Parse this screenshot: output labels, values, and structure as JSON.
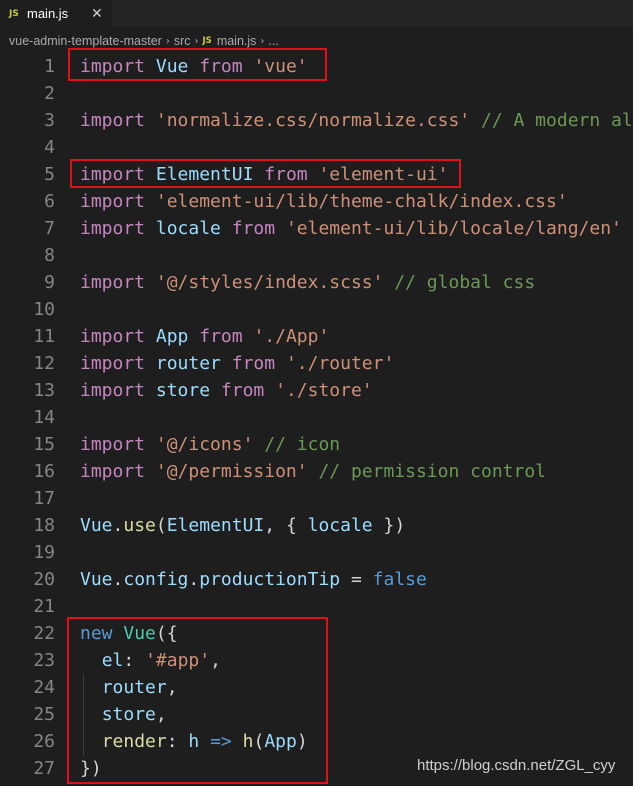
{
  "tab": {
    "icon": "JS",
    "filename": "main.js",
    "close_glyph": "✕"
  },
  "breadcrumb": {
    "folder": "vue-admin-template-master",
    "subfolder": "src",
    "file_icon": "JS",
    "file": "main.js",
    "symbol": "..."
  },
  "code_lines": [
    {
      "num": "1",
      "tokens": [
        [
          "kw",
          "import"
        ],
        [
          "pun",
          " "
        ],
        [
          "id",
          "Vue"
        ],
        [
          "pun",
          " "
        ],
        [
          "kw",
          "from"
        ],
        [
          "pun",
          " "
        ],
        [
          "str",
          "'vue'"
        ]
      ]
    },
    {
      "num": "2",
      "tokens": []
    },
    {
      "num": "3",
      "tokens": [
        [
          "kw",
          "import"
        ],
        [
          "pun",
          " "
        ],
        [
          "str",
          "'normalize.css/normalize.css'"
        ],
        [
          "pun",
          " "
        ],
        [
          "cmt",
          "// A modern al"
        ]
      ]
    },
    {
      "num": "4",
      "tokens": []
    },
    {
      "num": "5",
      "tokens": [
        [
          "kw",
          "import"
        ],
        [
          "pun",
          " "
        ],
        [
          "id",
          "ElementUI"
        ],
        [
          "pun",
          " "
        ],
        [
          "kw",
          "from"
        ],
        [
          "pun",
          " "
        ],
        [
          "str",
          "'element-ui'"
        ]
      ]
    },
    {
      "num": "6",
      "tokens": [
        [
          "kw",
          "import"
        ],
        [
          "pun",
          " "
        ],
        [
          "str",
          "'element-ui/lib/theme-chalk/index.css'"
        ]
      ]
    },
    {
      "num": "7",
      "tokens": [
        [
          "kw",
          "import"
        ],
        [
          "pun",
          " "
        ],
        [
          "id",
          "locale"
        ],
        [
          "pun",
          " "
        ],
        [
          "kw",
          "from"
        ],
        [
          "pun",
          " "
        ],
        [
          "str",
          "'element-ui/lib/locale/lang/en'"
        ]
      ]
    },
    {
      "num": "8",
      "tokens": []
    },
    {
      "num": "9",
      "tokens": [
        [
          "kw",
          "import"
        ],
        [
          "pun",
          " "
        ],
        [
          "str",
          "'@/styles/index.scss'"
        ],
        [
          "pun",
          " "
        ],
        [
          "cmt",
          "// global css"
        ]
      ]
    },
    {
      "num": "10",
      "tokens": []
    },
    {
      "num": "11",
      "tokens": [
        [
          "kw",
          "import"
        ],
        [
          "pun",
          " "
        ],
        [
          "id",
          "App"
        ],
        [
          "pun",
          " "
        ],
        [
          "kw",
          "from"
        ],
        [
          "pun",
          " "
        ],
        [
          "str",
          "'./App'"
        ]
      ]
    },
    {
      "num": "12",
      "tokens": [
        [
          "kw",
          "import"
        ],
        [
          "pun",
          " "
        ],
        [
          "id",
          "router"
        ],
        [
          "pun",
          " "
        ],
        [
          "kw",
          "from"
        ],
        [
          "pun",
          " "
        ],
        [
          "str",
          "'./router'"
        ]
      ]
    },
    {
      "num": "13",
      "tokens": [
        [
          "kw",
          "import"
        ],
        [
          "pun",
          " "
        ],
        [
          "id",
          "store"
        ],
        [
          "pun",
          " "
        ],
        [
          "kw",
          "from"
        ],
        [
          "pun",
          " "
        ],
        [
          "str",
          "'./store'"
        ]
      ]
    },
    {
      "num": "14",
      "tokens": []
    },
    {
      "num": "15",
      "tokens": [
        [
          "kw",
          "import"
        ],
        [
          "pun",
          " "
        ],
        [
          "str",
          "'@/icons'"
        ],
        [
          "pun",
          " "
        ],
        [
          "cmt",
          "// icon"
        ]
      ]
    },
    {
      "num": "16",
      "tokens": [
        [
          "kw",
          "import"
        ],
        [
          "pun",
          " "
        ],
        [
          "str",
          "'@/permission'"
        ],
        [
          "pun",
          " "
        ],
        [
          "cmt",
          "// permission control"
        ]
      ]
    },
    {
      "num": "17",
      "tokens": []
    },
    {
      "num": "18",
      "tokens": [
        [
          "id",
          "Vue"
        ],
        [
          "pun",
          "."
        ],
        [
          "fn",
          "use"
        ],
        [
          "pun",
          "("
        ],
        [
          "id",
          "ElementUI"
        ],
        [
          "pun",
          ", { "
        ],
        [
          "id",
          "locale"
        ],
        [
          "pun",
          " })"
        ]
      ]
    },
    {
      "num": "19",
      "tokens": []
    },
    {
      "num": "20",
      "tokens": [
        [
          "id",
          "Vue"
        ],
        [
          "pun",
          "."
        ],
        [
          "id",
          "config"
        ],
        [
          "pun",
          "."
        ],
        [
          "id",
          "productionTip"
        ],
        [
          "pun",
          " = "
        ],
        [
          "kw2",
          "false"
        ]
      ]
    },
    {
      "num": "21",
      "tokens": []
    },
    {
      "num": "22",
      "tokens": [
        [
          "kw2",
          "new"
        ],
        [
          "pun",
          " "
        ],
        [
          "cls",
          "Vue"
        ],
        [
          "pun",
          "({"
        ]
      ]
    },
    {
      "num": "23",
      "tokens": [
        [
          "pun",
          "  "
        ],
        [
          "id",
          "el"
        ],
        [
          "pun",
          ": "
        ],
        [
          "str",
          "'#app'"
        ],
        [
          "pun",
          ","
        ]
      ]
    },
    {
      "num": "24",
      "tokens": [
        [
          "pun",
          "  "
        ],
        [
          "id",
          "router"
        ],
        [
          "pun",
          ","
        ]
      ]
    },
    {
      "num": "25",
      "tokens": [
        [
          "pun",
          "  "
        ],
        [
          "id",
          "store"
        ],
        [
          "pun",
          ","
        ]
      ]
    },
    {
      "num": "26",
      "tokens": [
        [
          "pun",
          "  "
        ],
        [
          "fn",
          "render"
        ],
        [
          "pun",
          ": "
        ],
        [
          "id",
          "h"
        ],
        [
          "pun",
          " "
        ],
        [
          "kw2",
          "=>"
        ],
        [
          "pun",
          " "
        ],
        [
          "fn",
          "h"
        ],
        [
          "pun",
          "("
        ],
        [
          "id",
          "App"
        ],
        [
          "pun",
          ")"
        ]
      ]
    },
    {
      "num": "27",
      "tokens": [
        [
          "pun",
          "})"
        ]
      ]
    }
  ],
  "watermark": "https://blog.csdn.net/ZGL_cyy",
  "colors": {
    "background": "#1e1e1e",
    "highlight_box": "#e0101a",
    "keyword": "#c586c0",
    "string": "#ce9178",
    "comment": "#6a9955",
    "identifier": "#9cdcfe"
  }
}
